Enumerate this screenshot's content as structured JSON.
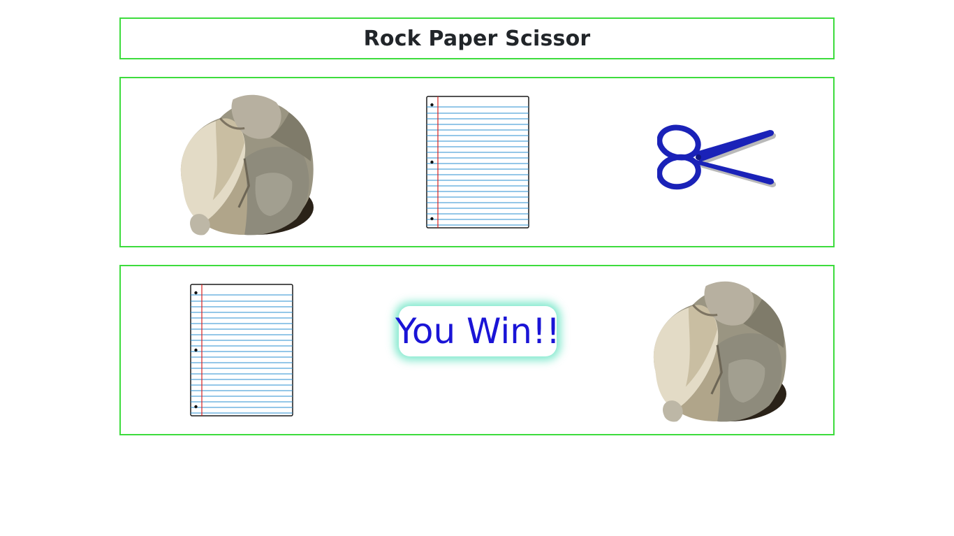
{
  "header": {
    "title": "Rock Paper Scissor"
  },
  "choices": [
    {
      "id": "rock",
      "icon": "rock-icon"
    },
    {
      "id": "paper",
      "icon": "paper-icon"
    },
    {
      "id": "scissor",
      "icon": "scissors-icon"
    }
  ],
  "result": {
    "player_choice": "paper",
    "computer_choice": "rock",
    "message": "You Win!!"
  },
  "colors": {
    "panel_border": "#3ddc3d",
    "result_text": "#1a14d6",
    "result_glow": "#5ae2be",
    "scissors": "#1a22b8",
    "paper_lines": "#2a8fd0",
    "paper_margin": "#d82020"
  }
}
